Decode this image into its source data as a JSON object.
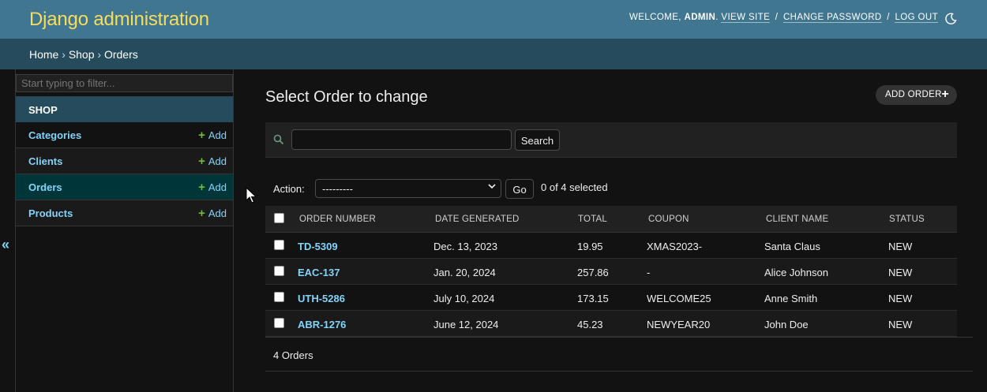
{
  "header": {
    "title": "Django administration",
    "welcome": "Welcome,",
    "username": "admin",
    "view_site": "View site",
    "change_password": "Change password",
    "log_out": "Log out",
    "theme_icon": "moon-icon"
  },
  "breadcrumbs": {
    "home": "Home",
    "app": "Shop",
    "current": "Orders",
    "separator": "›"
  },
  "sidebar": {
    "filter_placeholder": "Start typing to filter...",
    "app_name": "Shop",
    "items": [
      {
        "label": "Categories",
        "add": "Add"
      },
      {
        "label": "Clients",
        "add": "Add"
      },
      {
        "label": "Orders",
        "add": "Add",
        "active": true
      },
      {
        "label": "Products",
        "add": "Add"
      }
    ],
    "toggle_label": "«"
  },
  "main": {
    "title": "Select Order to change",
    "add_button": "Add Order",
    "search_button": "Search",
    "search_value": "",
    "action_label": "Action:",
    "action_selected": "---------",
    "go_button": "Go",
    "selection_counter": "0 of 4 selected",
    "columns": [
      "Order Number",
      "Date Generated",
      "Total",
      "Coupon",
      "Client Name",
      "Status"
    ],
    "rows": [
      {
        "order": "TD-5309",
        "date": "Dec. 13, 2023",
        "total": "19.95",
        "coupon": "XMAS2023-",
        "client": "Santa Claus",
        "status": "NEW"
      },
      {
        "order": "EAC-137",
        "date": "Jan. 20, 2024",
        "total": "257.86",
        "coupon": "-",
        "client": "Alice Johnson",
        "status": "NEW"
      },
      {
        "order": "UTH-5286",
        "date": "July 10, 2024",
        "total": "173.15",
        "coupon": "WELCOME25",
        "client": "Anne Smith",
        "status": "NEW"
      },
      {
        "order": "ABR-1276",
        "date": "June 12, 2024",
        "total": "45.23",
        "coupon": "NEWYEAR20",
        "client": "John Doe",
        "status": "NEW"
      }
    ],
    "paginator": "4 Orders"
  },
  "colors": {
    "header_bg": "#417690",
    "branding": "#f5dd5d",
    "breadcrumbs_bg": "#264b5d",
    "link": "#81d4fa",
    "add_plus": "#70bf2b"
  }
}
